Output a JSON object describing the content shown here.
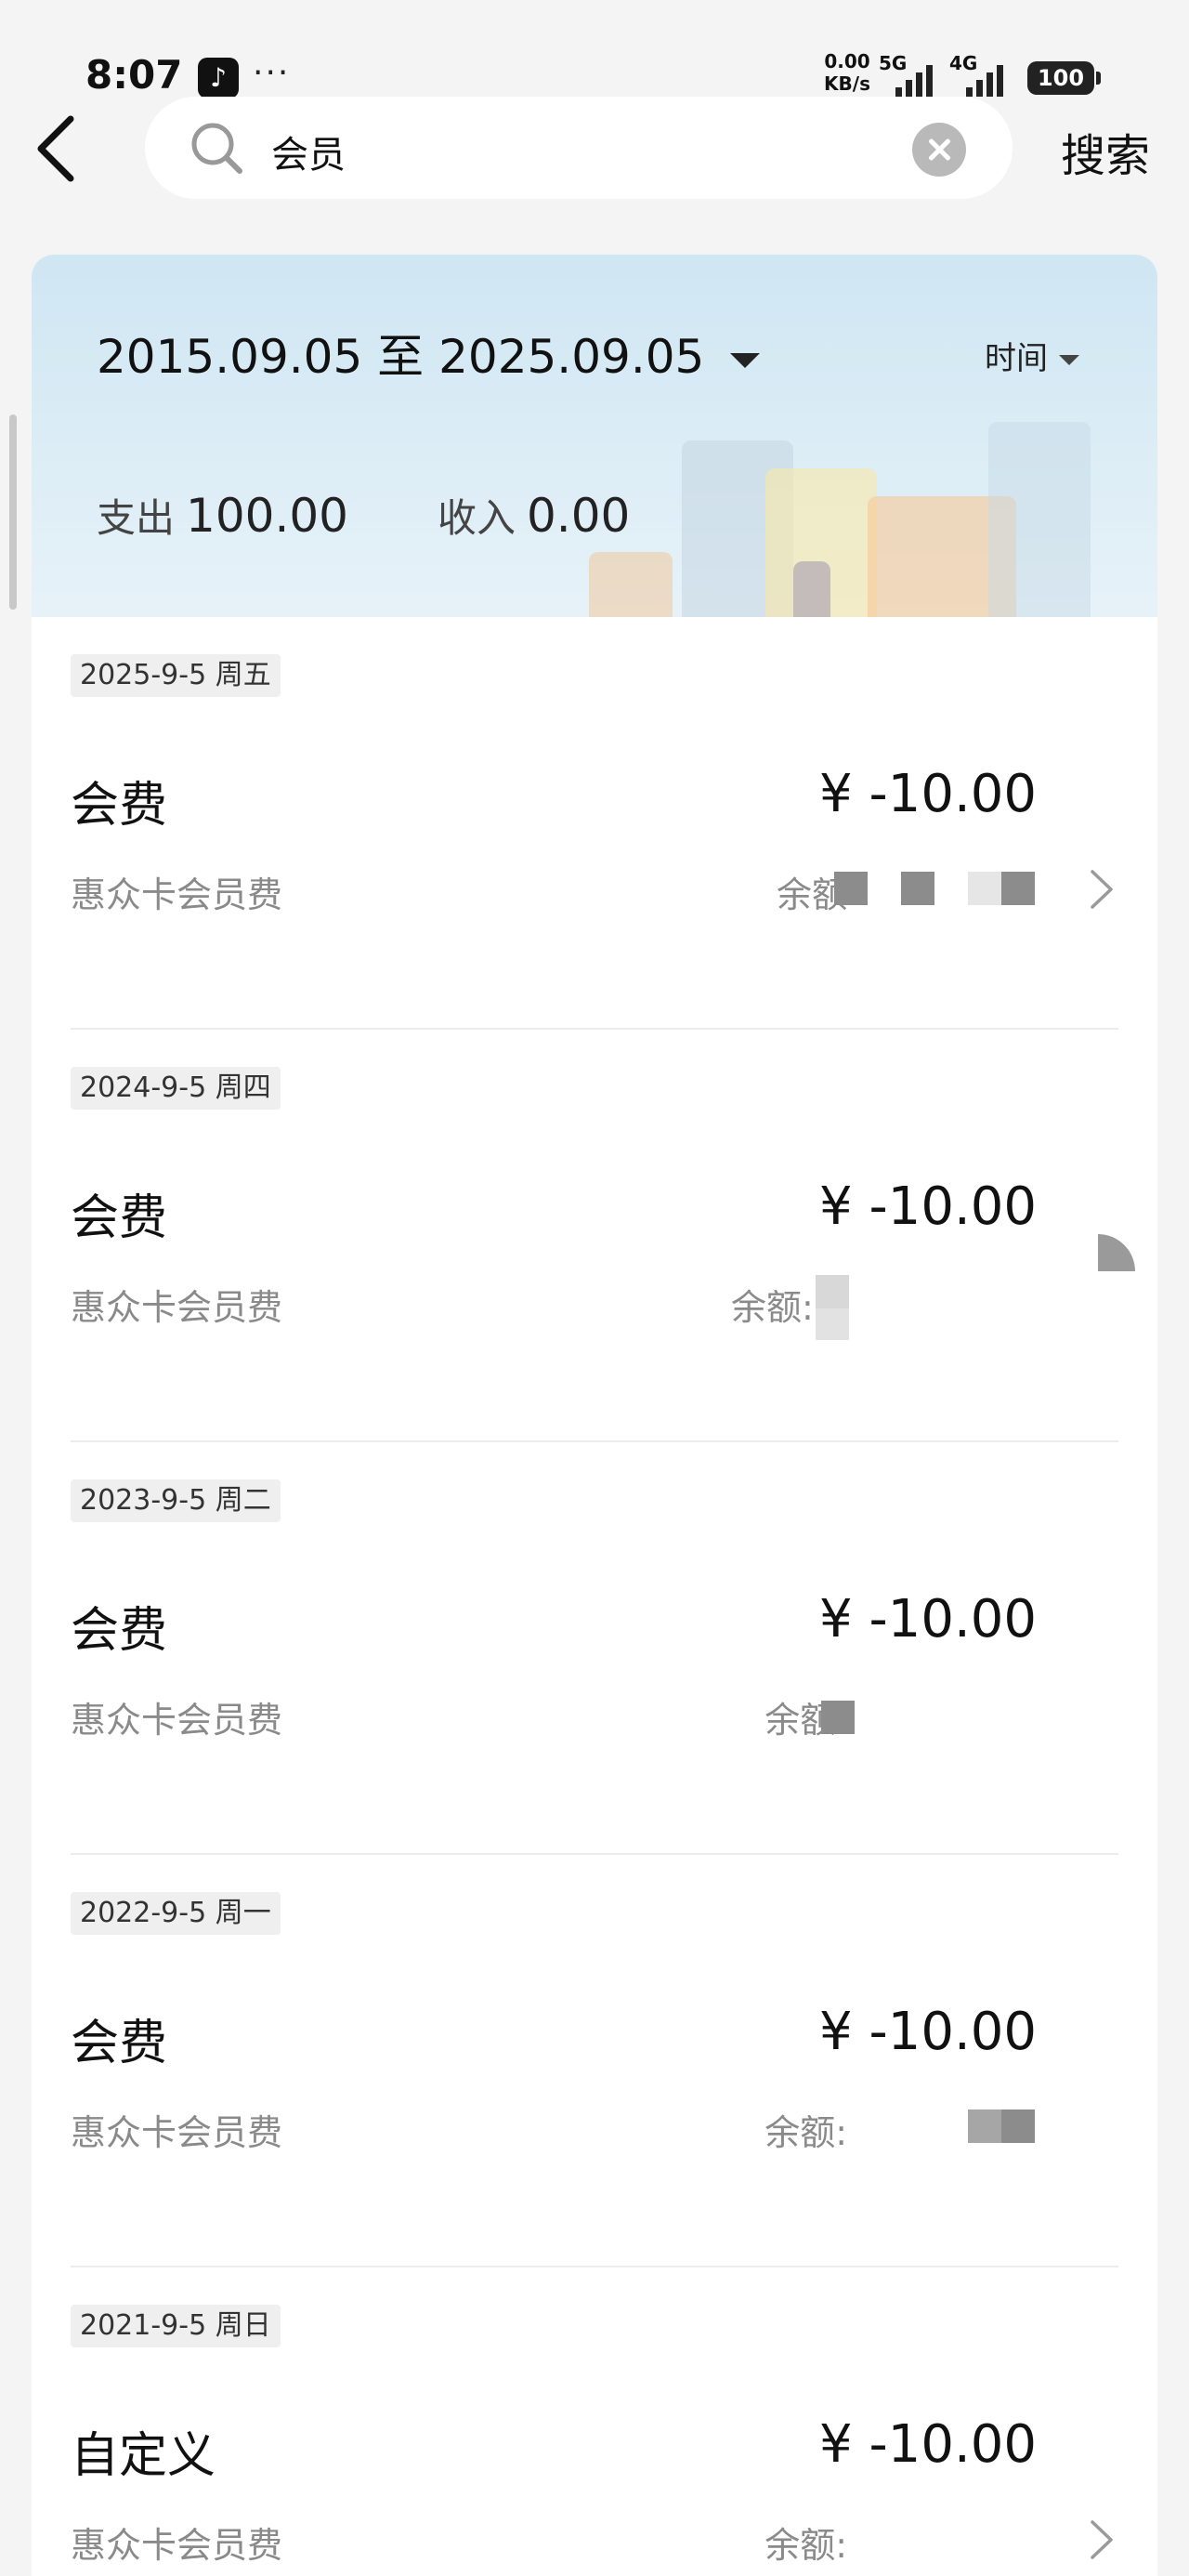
{
  "status_bar": {
    "time": "8:07",
    "more": "···",
    "net_speed_value": "0.00",
    "net_speed_unit": "KB/s",
    "signal_1_label": "5G",
    "signal_2_label": "4G",
    "battery": "100"
  },
  "search": {
    "query": "会员",
    "submit_label": "搜索"
  },
  "filter": {
    "date_range": "2015.09.05 至 2025.09.05",
    "sort_label": "时间"
  },
  "summary": {
    "expense_label": "支出",
    "expense_value": "100.00",
    "income_label": "收入",
    "income_value": "0.00"
  },
  "records": [
    {
      "date": "2025-9-5 周五",
      "title": "会费",
      "amount": "¥ -10.00",
      "desc": "惠众卡会员费",
      "balance_label": "余额"
    },
    {
      "date": "2024-9-5 周四",
      "title": "会费",
      "amount": "¥ -10.00",
      "desc": "惠众卡会员费",
      "balance_label": "余额: ¥"
    },
    {
      "date": "2023-9-5 周二",
      "title": "会费",
      "amount": "¥ -10.00",
      "desc": "惠众卡会员费",
      "balance_label": "余额:"
    },
    {
      "date": "2022-9-5 周一",
      "title": "会费",
      "amount": "¥ -10.00",
      "desc": "惠众卡会员费",
      "balance_label": "余额:"
    },
    {
      "date": "2021-9-5 周日",
      "title": "自定义",
      "amount": "¥ -10.00",
      "desc": "惠众卡会员费",
      "balance_label": "余额:"
    }
  ]
}
